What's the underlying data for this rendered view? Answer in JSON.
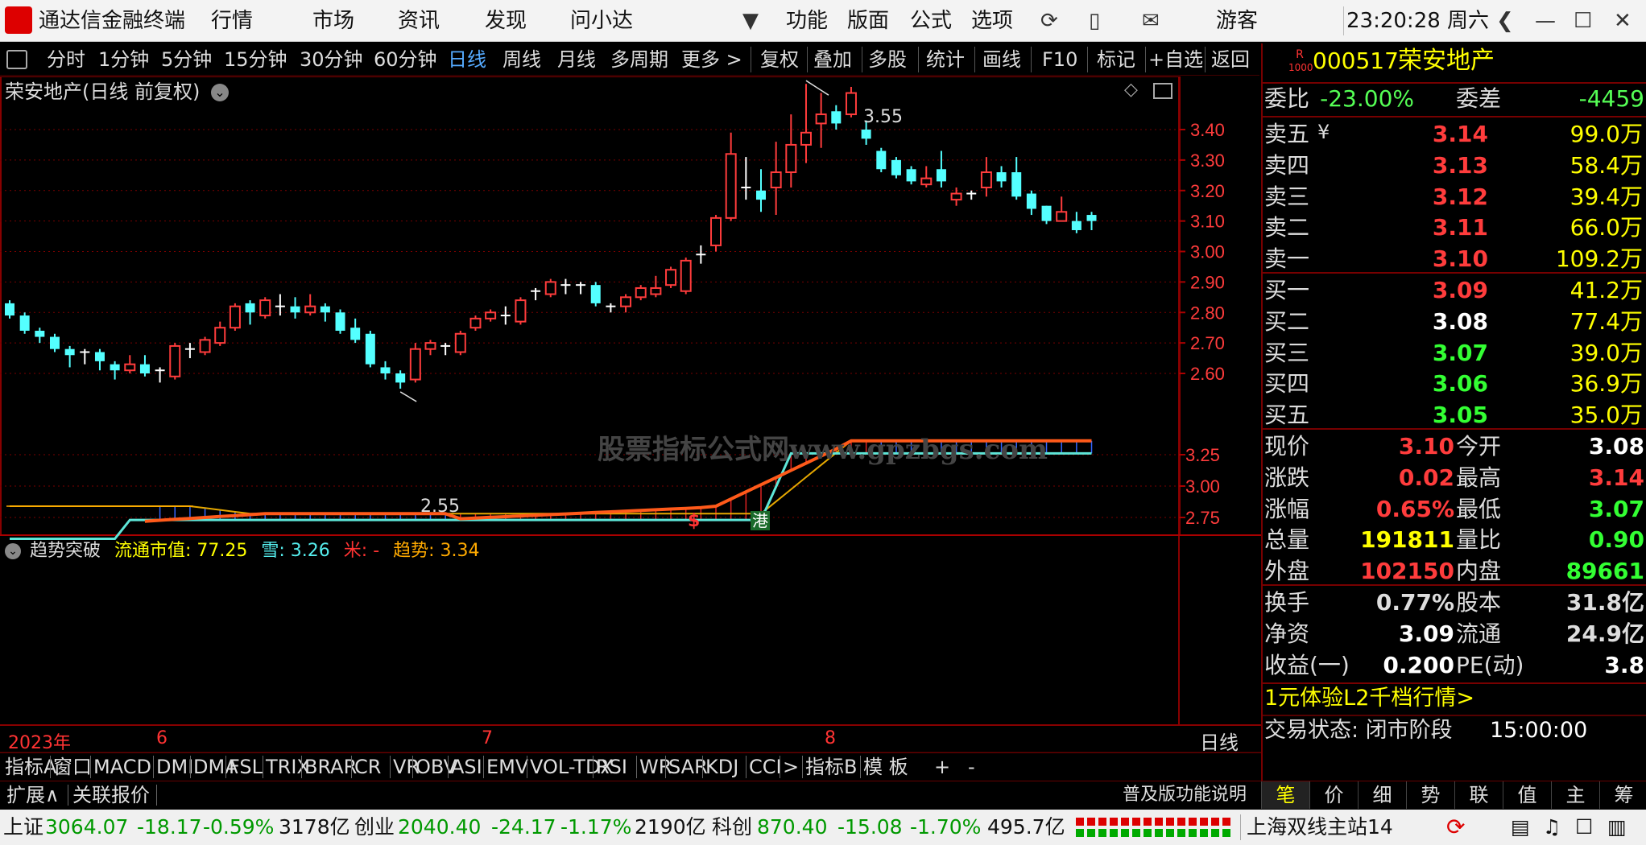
{
  "app": {
    "title": "通达信金融终端",
    "menu": [
      "行情",
      "市场",
      "资讯",
      "发现",
      "问小达"
    ],
    "menu2": [
      "功能",
      "版面",
      "公式",
      "选项"
    ],
    "user": "游客",
    "clock": "23:20:28 周六"
  },
  "periods": [
    "分时",
    "1分钟",
    "5分钟",
    "15分钟",
    "30分钟",
    "60分钟",
    "日线",
    "周线",
    "月线",
    "多周期",
    "更多 >"
  ],
  "active_period": "日线",
  "tools": [
    "复权",
    "叠加",
    "多股",
    "统计",
    "画线",
    "F10",
    "标记",
    "+自选",
    "返回"
  ],
  "chart": {
    "title": "荣安地产(日线 前复权)",
    "high_label": "3.55",
    "low_label": "2.55",
    "markers": [
      "$",
      "港"
    ],
    "price_ticks": [
      "3.40",
      "3.30",
      "3.20",
      "3.10",
      "3.00",
      "2.90",
      "2.80",
      "2.70",
      "2.60"
    ],
    "watermark": "股票指标公式网www.gpzbgs.com",
    "indicator": {
      "name": "趋势突破",
      "l1": "流通市值: 77.25",
      "l2": "雪: 3.26",
      "l3": "米: -",
      "l4": "趋势: 3.34"
    },
    "ind_ticks": [
      "3.25",
      "3.00",
      "2.75"
    ],
    "date_labels": [
      "2023年",
      "6",
      "7",
      "8"
    ],
    "cycle": "日线"
  },
  "chart_data": {
    "type": "candlestick",
    "title": "荣安地产(日线 前复权)",
    "ylim": [
      2.5,
      3.6
    ],
    "y_ticks": [
      2.6,
      2.7,
      2.8,
      2.9,
      3.0,
      3.1,
      3.2,
      3.3,
      3.4
    ],
    "x_labels": [
      "2023年",
      "6",
      "7",
      "8"
    ],
    "high": 3.55,
    "low": 2.55,
    "candles": [
      [
        2.83,
        2.79,
        2.84,
        2.78
      ],
      [
        2.79,
        2.74,
        2.8,
        2.73
      ],
      [
        2.74,
        2.72,
        2.75,
        2.7
      ],
      [
        2.72,
        2.68,
        2.73,
        2.67
      ],
      [
        2.68,
        2.66,
        2.69,
        2.62
      ],
      [
        2.66,
        2.67,
        2.68,
        2.63
      ],
      [
        2.67,
        2.64,
        2.68,
        2.61
      ],
      [
        2.63,
        2.61,
        2.64,
        2.58
      ],
      [
        2.61,
        2.63,
        2.66,
        2.6
      ],
      [
        2.63,
        2.6,
        2.66,
        2.59
      ],
      [
        2.6,
        2.61,
        2.62,
        2.57
      ],
      [
        2.59,
        2.69,
        2.7,
        2.58
      ],
      [
        2.68,
        2.68,
        2.7,
        2.65
      ],
      [
        2.67,
        2.71,
        2.72,
        2.66
      ],
      [
        2.7,
        2.75,
        2.77,
        2.69
      ],
      [
        2.75,
        2.82,
        2.83,
        2.74
      ],
      [
        2.83,
        2.8,
        2.84,
        2.76
      ],
      [
        2.79,
        2.84,
        2.85,
        2.78
      ],
      [
        2.82,
        2.81,
        2.86,
        2.79
      ],
      [
        2.82,
        2.8,
        2.85,
        2.78
      ],
      [
        2.8,
        2.82,
        2.86,
        2.79
      ],
      [
        2.82,
        2.8,
        2.83,
        2.77
      ],
      [
        2.8,
        2.74,
        2.81,
        2.73
      ],
      [
        2.75,
        2.71,
        2.78,
        2.7
      ],
      [
        2.73,
        2.63,
        2.74,
        2.62
      ],
      [
        2.62,
        2.6,
        2.64,
        2.58
      ],
      [
        2.6,
        2.57,
        2.61,
        2.55
      ],
      [
        2.58,
        2.68,
        2.7,
        2.57
      ],
      [
        2.68,
        2.7,
        2.71,
        2.66
      ],
      [
        2.69,
        2.68,
        2.7,
        2.66
      ],
      [
        2.67,
        2.73,
        2.74,
        2.66
      ],
      [
        2.75,
        2.78,
        2.79,
        2.74
      ],
      [
        2.78,
        2.8,
        2.81,
        2.77
      ],
      [
        2.79,
        2.78,
        2.82,
        2.76
      ],
      [
        2.77,
        2.84,
        2.85,
        2.76
      ],
      [
        2.86,
        2.87,
        2.88,
        2.84
      ],
      [
        2.86,
        2.9,
        2.91,
        2.85
      ],
      [
        2.89,
        2.88,
        2.91,
        2.86
      ],
      [
        2.88,
        2.89,
        2.9,
        2.86
      ],
      [
        2.89,
        2.83,
        2.9,
        2.82
      ],
      [
        2.82,
        2.81,
        2.83,
        2.8
      ],
      [
        2.82,
        2.85,
        2.86,
        2.8
      ],
      [
        2.85,
        2.88,
        2.89,
        2.84
      ],
      [
        2.86,
        2.88,
        2.92,
        2.85
      ],
      [
        2.89,
        2.94,
        2.95,
        2.88
      ],
      [
        2.87,
        2.97,
        2.98,
        2.86
      ],
      [
        2.98,
        2.99,
        3.02,
        2.96
      ],
      [
        3.02,
        3.11,
        3.12,
        3.0
      ],
      [
        3.11,
        3.32,
        3.39,
        3.1
      ],
      [
        3.21,
        3.2,
        3.31,
        3.17
      ],
      [
        3.2,
        3.17,
        3.27,
        3.13
      ],
      [
        3.21,
        3.26,
        3.36,
        3.12
      ],
      [
        3.26,
        3.35,
        3.45,
        3.21
      ],
      [
        3.35,
        3.39,
        3.55,
        3.29
      ],
      [
        3.42,
        3.45,
        3.52,
        3.34
      ],
      [
        3.46,
        3.42,
        3.48,
        3.4
      ],
      [
        3.45,
        3.52,
        3.54,
        3.44
      ],
      [
        3.4,
        3.37,
        3.43,
        3.35
      ],
      [
        3.33,
        3.27,
        3.34,
        3.26
      ],
      [
        3.3,
        3.25,
        3.31,
        3.24
      ],
      [
        3.27,
        3.23,
        3.28,
        3.22
      ],
      [
        3.22,
        3.24,
        3.28,
        3.21
      ],
      [
        3.27,
        3.23,
        3.33,
        3.21
      ],
      [
        3.17,
        3.19,
        3.21,
        3.15
      ],
      [
        3.18,
        3.19,
        3.2,
        3.17
      ],
      [
        3.21,
        3.26,
        3.31,
        3.18
      ],
      [
        3.26,
        3.23,
        3.28,
        3.21
      ],
      [
        3.26,
        3.18,
        3.31,
        3.17
      ],
      [
        3.19,
        3.14,
        3.2,
        3.12
      ],
      [
        3.15,
        3.1,
        3.15,
        3.09
      ],
      [
        3.1,
        3.13,
        3.18,
        3.1
      ],
      [
        3.1,
        3.07,
        3.13,
        3.06
      ],
      [
        3.12,
        3.1,
        3.13,
        3.07
      ]
    ],
    "indicator_ylim": [
      2.55,
      3.4
    ],
    "indicator_ticks": [
      3.25,
      3.0,
      2.75
    ],
    "trend": {
      "name": "趋势",
      "last": 3.34
    },
    "snow": {
      "name": "雪",
      "last": 3.26
    }
  },
  "quote": {
    "badge_top": "R",
    "badge_bot": "1000",
    "code": "000517",
    "name": "荣安地产",
    "wb_label": "委比",
    "wb": "-23.00%",
    "wc_label": "委差",
    "wc": "-4459",
    "asks": [
      {
        "label": "卖五",
        "price": "3.14",
        "vol": "99.0万"
      },
      {
        "label": "卖四",
        "price": "3.13",
        "vol": "58.4万"
      },
      {
        "label": "卖三",
        "price": "3.12",
        "vol": "39.4万"
      },
      {
        "label": "卖二",
        "price": "3.11",
        "vol": "66.0万"
      },
      {
        "label": "卖一",
        "price": "3.10",
        "vol": "109.2万"
      }
    ],
    "bids": [
      {
        "label": "买一",
        "price": "3.09",
        "vol": "41.2万"
      },
      {
        "label": "买二",
        "price": "3.08",
        "vol": "77.4万"
      },
      {
        "label": "买三",
        "price": "3.07",
        "vol": "39.0万"
      },
      {
        "label": "买四",
        "price": "3.06",
        "vol": "36.9万"
      },
      {
        "label": "买五",
        "price": "3.05",
        "vol": "35.0万"
      }
    ],
    "stats": [
      {
        "l1": "现价",
        "v1": "3.10",
        "l2": "今开",
        "v2": "3.08"
      },
      {
        "l1": "涨跌",
        "v1": "0.02",
        "l2": "最高",
        "v2": "3.14"
      },
      {
        "l1": "涨幅",
        "v1": "0.65%",
        "l2": "最低",
        "v2": "3.07"
      },
      {
        "l1": "总量",
        "v1": "191811",
        "l2": "量比",
        "v2": "0.90"
      },
      {
        "l1": "外盘",
        "v1": "102150",
        "l2": "内盘",
        "v2": "89661"
      }
    ],
    "stats2": [
      {
        "l1": "换手",
        "v1": "0.77%",
        "l2": "股本",
        "v2": "31.8亿"
      },
      {
        "l1": "净资",
        "v1": "3.09",
        "l2": "流通",
        "v2": "24.9亿"
      },
      {
        "l1": "收益(一)",
        "v1": "0.200",
        "l2": "PE(动)",
        "v2": "3.8"
      }
    ],
    "promo": "1元体验L2千档行情>",
    "trade_status_label": "交易状态: 闭市阶段",
    "trade_time": "15:00:00",
    "bottom_tabs": [
      "笔",
      "价",
      "细",
      "势",
      "联",
      "值",
      "主",
      "筹"
    ]
  },
  "ind_tabs": [
    "指标A",
    "窗口",
    "MACD",
    "DMI",
    "DMA",
    "FSL",
    "TRIX",
    "BRAR",
    "CR",
    "VR",
    "OBV",
    "ASI",
    "EMV",
    "VOL-TDX",
    "RSI",
    "WR",
    "SAR",
    "KDJ",
    "CCI",
    ">",
    "指标B",
    "模 板",
    "+",
    "-"
  ],
  "ext": {
    "expand": "扩展∧",
    "related": "关联报价",
    "help": "普及版功能说明"
  },
  "status": {
    "sh_label": "上证",
    "sh_val": "3064.07",
    "sh_chg": "-18.17",
    "sh_pct": "-0.59%",
    "sh_amt": "3178亿",
    "cy_label": "创业",
    "cy_val": "2040.40",
    "cy_chg": "-24.17",
    "cy_pct": "-1.17%",
    "cy_amt": "2190亿",
    "kc_label": "科创",
    "kc_val": "870.40",
    "kc_chg": "-15.08",
    "kc_pct": "-1.70%",
    "kc_amt": "495.7亿",
    "server": "上海双线主站14"
  },
  "colors": {
    "up": "#ff3c3c",
    "down": "#54ffff",
    "gold": "#ffff00",
    "grid": "#7a0000"
  }
}
